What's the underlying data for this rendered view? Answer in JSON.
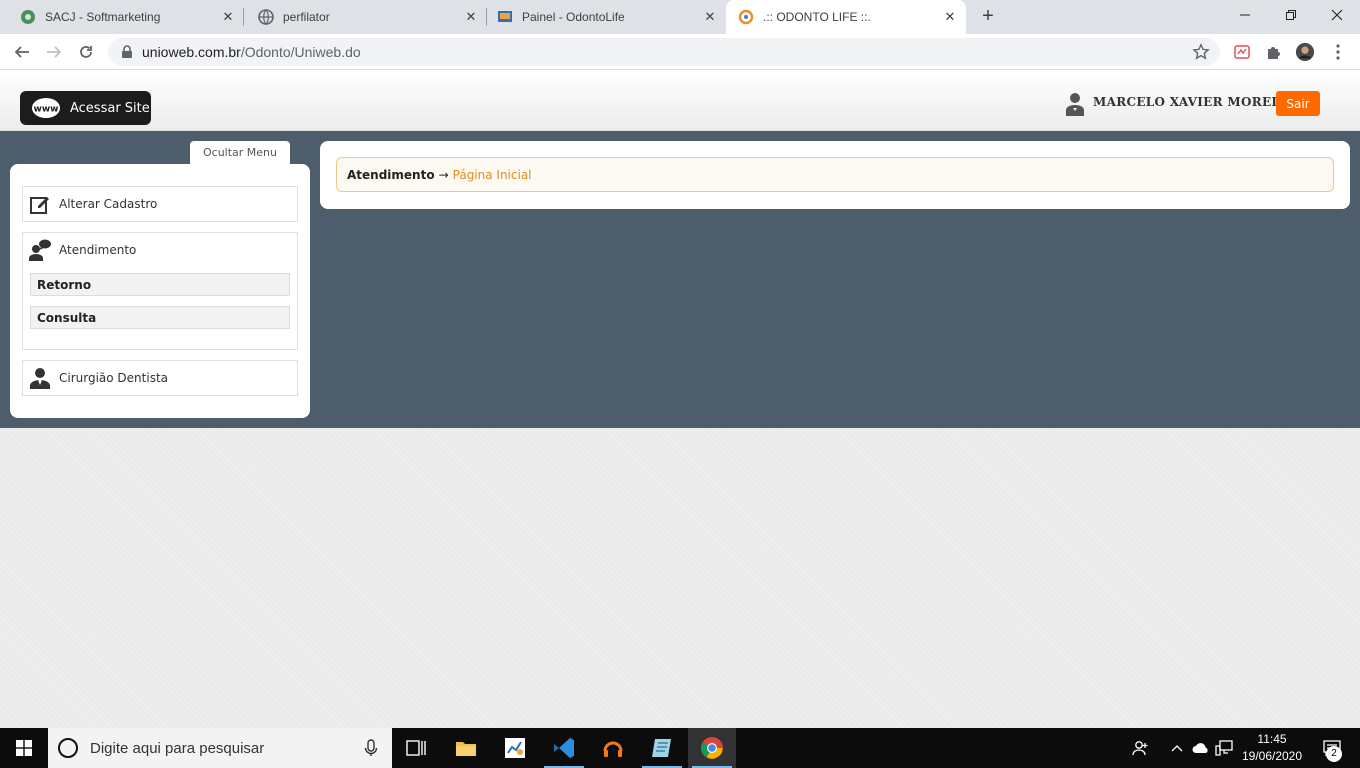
{
  "browser": {
    "tabs": [
      {
        "title": "SACJ - Softmarketing",
        "close": "✕"
      },
      {
        "title": "perfilator",
        "close": "✕"
      },
      {
        "title": "Painel - OdontoLife",
        "close": "✕"
      },
      {
        "title": ".:: ODONTO LIFE ::.",
        "close": "✕"
      }
    ],
    "new_tab": "+",
    "url_host": "unioweb.com.br",
    "url_path": "/Odonto/Uniweb.do"
  },
  "header": {
    "acessar_site": "Acessar Site",
    "user_name": "MARCELO XAVIER MOREIRA",
    "logout": "Sair"
  },
  "sidebar": {
    "toggle_label": "Ocultar Menu",
    "items": [
      {
        "label": "Alterar Cadastro",
        "icon": "edit-icon"
      },
      {
        "label": "Atendimento",
        "icon": "chat-user-icon",
        "subitems": [
          "Retorno",
          "Consulta"
        ]
      },
      {
        "label": "Cirurgião Dentista",
        "icon": "dentist-icon"
      }
    ]
  },
  "breadcrumb": {
    "root": "Atendimento",
    "arrow": "→",
    "current": "Página Inicial"
  },
  "taskbar": {
    "search_placeholder": "Digite aqui para pesquisar",
    "time": "11:45",
    "date": "19/06/2020",
    "notifications": "2"
  },
  "colors": {
    "accent": "#ff6a00",
    "band": "#4d5d6b",
    "breadcrumb_current": "#e08e1f"
  }
}
